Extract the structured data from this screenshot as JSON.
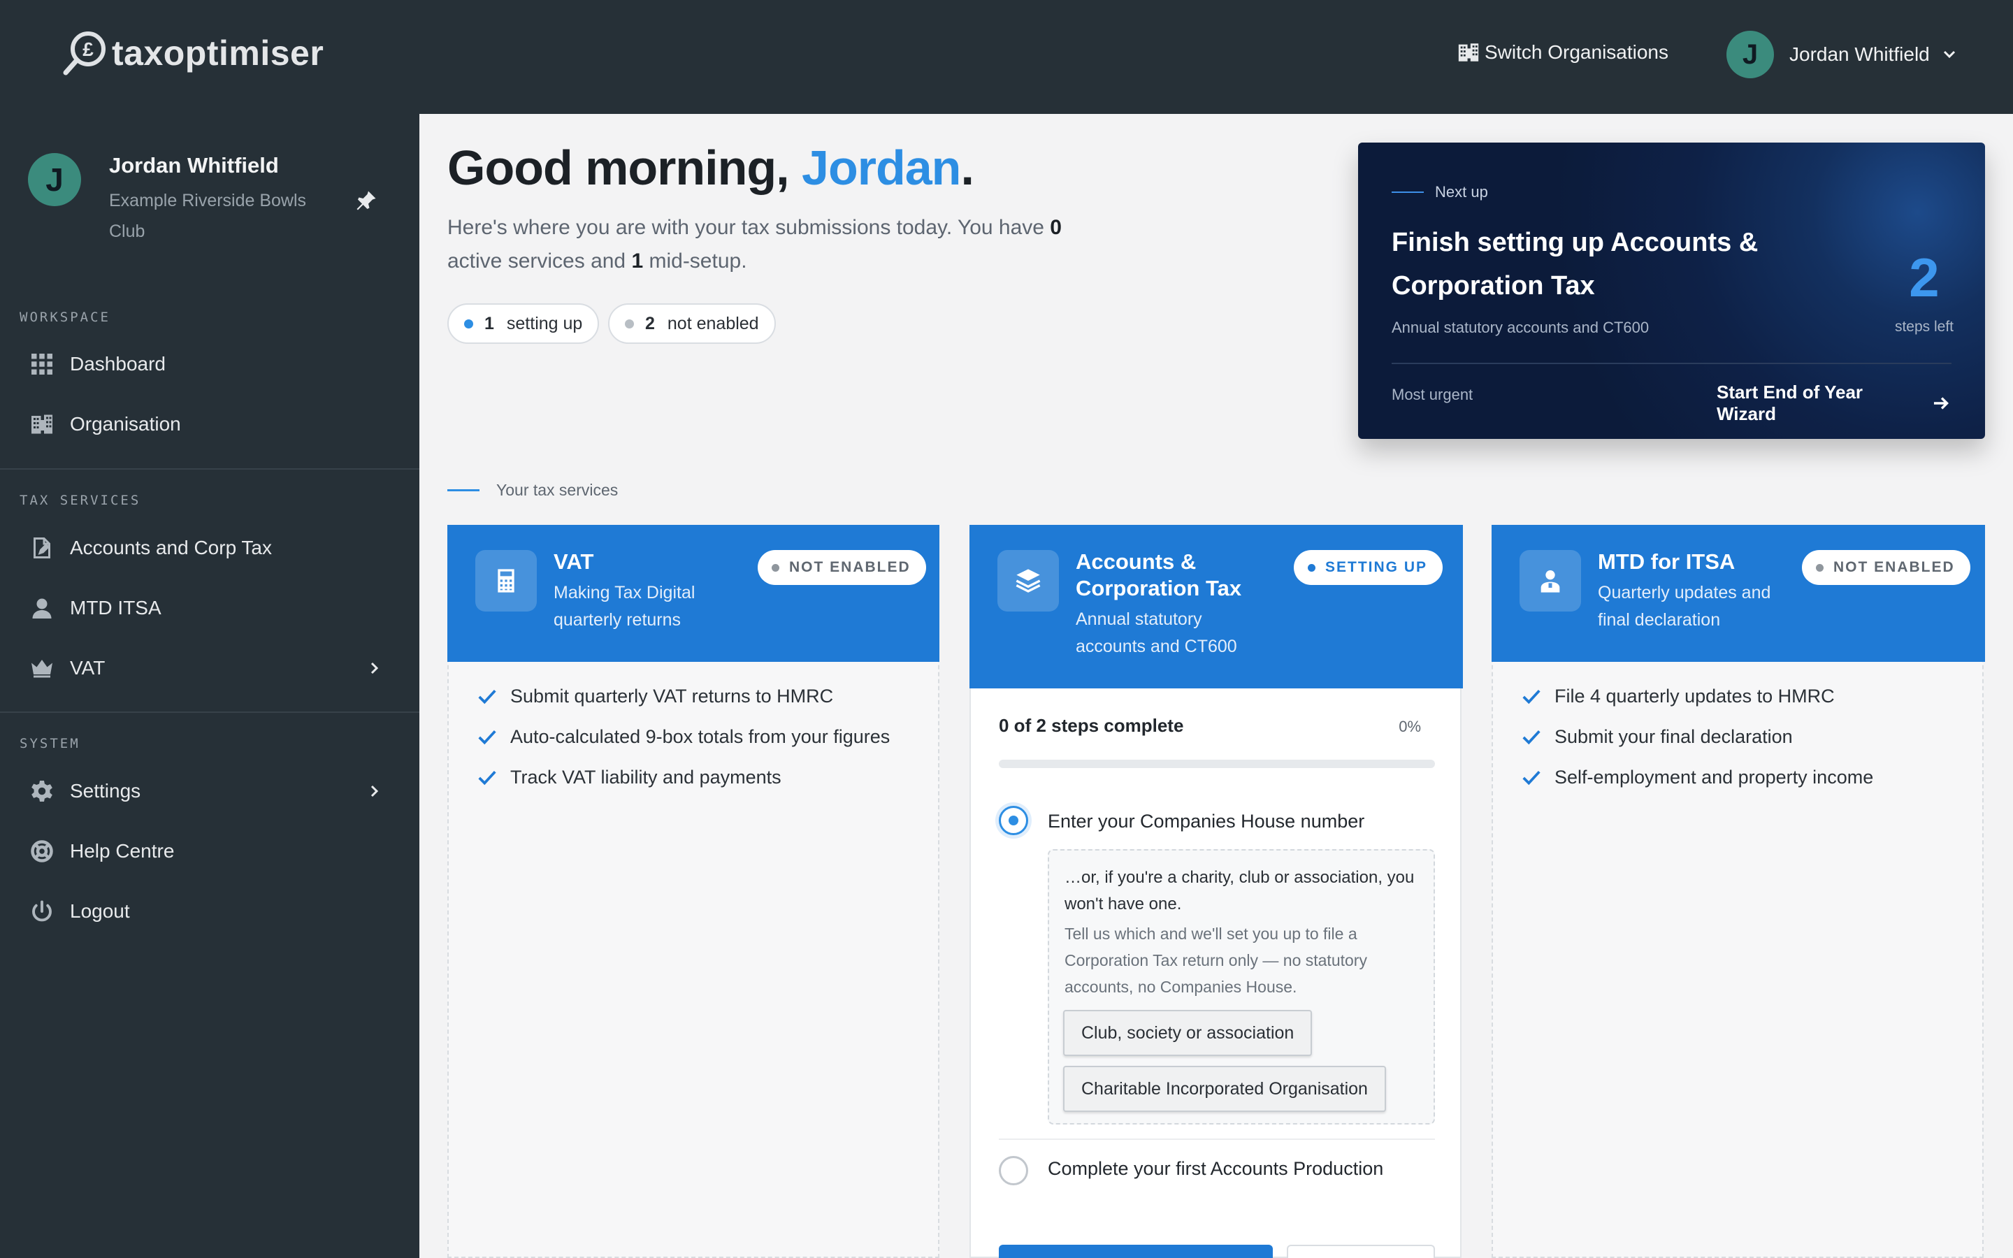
{
  "header": {
    "logo_text": "taxoptimiser",
    "switch_org_label": "Switch Organisations",
    "user_initial": "J",
    "user_name": "Jordan Whitfield"
  },
  "sidebar": {
    "profile": {
      "initial": "J",
      "name": "Jordan Whitfield",
      "org": "Example Riverside Bowls Club"
    },
    "sections": {
      "workspace": "WORKSPACE",
      "tax_services": "TAX SERVICES",
      "system": "SYSTEM"
    },
    "items": {
      "dashboard": "Dashboard",
      "organisation": "Organisation",
      "accounts_corp_tax": "Accounts and Corp Tax",
      "mtd_itsa": "MTD ITSA",
      "vat": "VAT",
      "settings": "Settings",
      "help_centre": "Help Centre",
      "logout": "Logout"
    }
  },
  "greeting": {
    "prefix": "Good morning, ",
    "name": "Jordan",
    "suffix": ".",
    "sub_1": "Here's where you are with your tax submissions today. You have ",
    "active_count": "0",
    "sub_2": " active services and ",
    "midsetup_count": "1",
    "sub_3": " mid-setup."
  },
  "chips": [
    {
      "count": "1",
      "label": "setting up",
      "color": "#2d8ee3"
    },
    {
      "count": "2",
      "label": "not enabled",
      "color": "#b8bec4"
    }
  ],
  "next_up": {
    "kicker": "Next up",
    "title": "Finish setting up Accounts & Corporation Tax",
    "subtitle": "Annual statutory accounts and CT600",
    "steps_left": "2",
    "steps_left_label": "steps left",
    "urgency": "Most urgent",
    "cta": "Start End of Year Wizard"
  },
  "services_label": "Your tax services",
  "services": {
    "vat": {
      "title": "VAT",
      "subtitle_1": "Making Tax Digital",
      "subtitle_2": "quarterly returns",
      "badge": "NOT ENABLED",
      "icon": "calculator-icon",
      "features": [
        "Submit quarterly VAT returns to HMRC",
        "Auto-calculated 9-box totals from your figures",
        "Track VAT liability and payments"
      ]
    },
    "accounts": {
      "title_1": "Accounts &",
      "title_2": "Corporation Tax",
      "subtitle_1": "Annual statutory",
      "subtitle_2": "accounts and CT600",
      "badge": "SETTING UP",
      "icon": "layers-icon",
      "progress_label": "0 of 2 steps complete",
      "progress_pct": "0%",
      "progress_value": 0,
      "step_1": "Enter your Companies House number",
      "step_1_lead": "…or, if you're a charity, club or association, you won't have one.",
      "step_1_body": "Tell us which and we'll set you up to file a Corporation Tax return only — no statutory accounts, no Companies House.",
      "option_1": "Club, society or association",
      "option_2": "Charitable Incorporated Organisation",
      "step_2": "Complete your first Accounts Production"
    },
    "itsa": {
      "title": "MTD for ITSA",
      "subtitle_1": "Quarterly updates and",
      "subtitle_2": "final declaration",
      "badge": "NOT ENABLED",
      "icon": "person-badge-icon",
      "features": [
        "File 4 quarterly updates to HMRC",
        "Submit your final declaration",
        "Self-employment and property income"
      ]
    }
  },
  "colors": {
    "accent": "#1f7ad5",
    "accent_light": "#2d8ee3",
    "sidebar_bg": "#263037",
    "next_card_bg": "#0e2147"
  }
}
